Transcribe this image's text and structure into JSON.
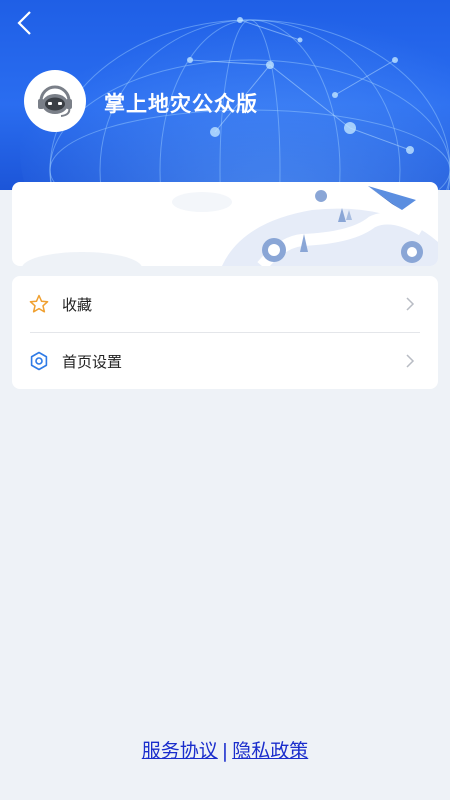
{
  "header": {
    "back_icon": "chevron-left-icon",
    "avatar_icon": "robot-headset-icon",
    "app_name": "掌上地灾公众版",
    "accent": "#2a6df0"
  },
  "menu": {
    "items": [
      {
        "label": "收藏",
        "icon": "star-icon",
        "icon_color": "#f0a030"
      },
      {
        "label": "首页设置",
        "icon": "gear-icon",
        "icon_color": "#2f7be6"
      }
    ],
    "arrow_icon": "chevron-right-icon"
  },
  "footer": {
    "service_agreement": "服务协议",
    "separator": "|",
    "privacy_policy": "隐私政策",
    "link_color": "#1a2dcc"
  }
}
